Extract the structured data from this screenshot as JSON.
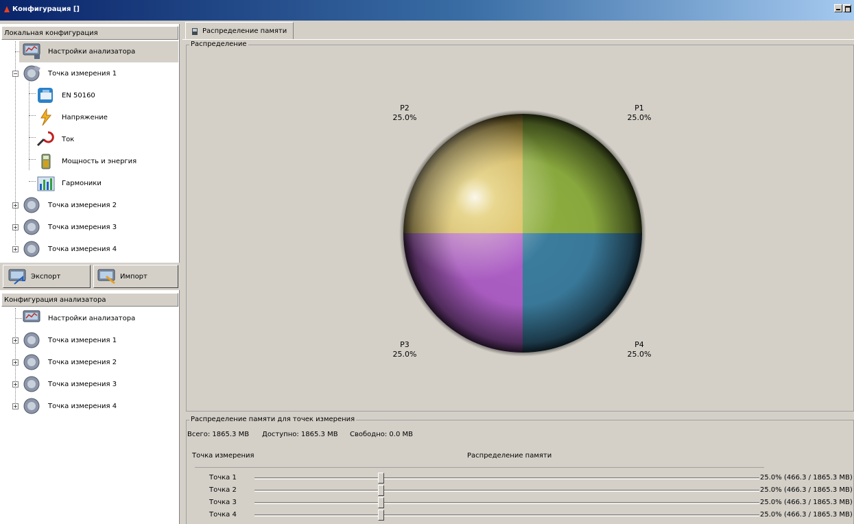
{
  "window": {
    "title": "Конфигурация []"
  },
  "local_config": {
    "header": "Локальная конфигурация",
    "items": [
      {
        "label": "Настройки анализатора",
        "icon": "analyzer-settings-icon"
      },
      {
        "label": "Точка измерения 1",
        "icon": "measurement-point-icon"
      },
      {
        "label": "EN 50160",
        "icon": "en50160-icon"
      },
      {
        "label": "Напряжение",
        "icon": "voltage-icon"
      },
      {
        "label": "Ток",
        "icon": "current-clamp-icon"
      },
      {
        "label": "Мощность и энергия",
        "icon": "power-energy-icon"
      },
      {
        "label": "Гармоники",
        "icon": "harmonics-icon"
      },
      {
        "label": "Точка измерения 2",
        "icon": "measurement-point-icon"
      },
      {
        "label": "Точка измерения 3",
        "icon": "measurement-point-icon"
      },
      {
        "label": "Точка измерения 4",
        "icon": "measurement-point-icon"
      }
    ]
  },
  "buttons": {
    "export": "Экспорт",
    "import": "Импорт"
  },
  "analyzer_config": {
    "header": "Конфигурация анализатора",
    "items": [
      {
        "label": "Настройки анализатора"
      },
      {
        "label": "Точка измерения 1"
      },
      {
        "label": "Точка измерения 2"
      },
      {
        "label": "Точка измерения 3"
      },
      {
        "label": "Точка измерения 4"
      }
    ]
  },
  "tab": {
    "label": "Распределение памяти"
  },
  "distribution": {
    "group_title": "Распределение",
    "labels": [
      {
        "name": "P2",
        "value": "25.0%"
      },
      {
        "name": "P1",
        "value": "25.0%"
      },
      {
        "name": "P3",
        "value": "25.0%"
      },
      {
        "name": "P4",
        "value": "25.0%"
      }
    ]
  },
  "chart_data": {
    "type": "pie",
    "categories": [
      "P1",
      "P2",
      "P3",
      "P4"
    ],
    "values": [
      25.0,
      25.0,
      25.0,
      25.0
    ],
    "colors": {
      "P1": "#8fb040",
      "P2": "#d8b850",
      "P3": "#b060c8",
      "P4": "#3c7ea0"
    }
  },
  "memory": {
    "group_title": "Распределение памяти для точек измерения",
    "total": "Всего: 1865.3 MB",
    "available": "Доступно: 1865.3 MB",
    "free": "Свободно: 0.0 MB",
    "col_point": "Точка измерения",
    "col_distribution": "Распределение памяти",
    "rows": [
      {
        "name": "Точка 1",
        "value": "25.0% (466.3 / 1865.3 MB)",
        "fraction": 0.25
      },
      {
        "name": "Точка 2",
        "value": "25.0% (466.3 / 1865.3 MB)",
        "fraction": 0.25
      },
      {
        "name": "Точка 3",
        "value": "25.0% (466.3 / 1865.3 MB)",
        "fraction": 0.25
      },
      {
        "name": "Точка 4",
        "value": "25.0% (466.3 / 1865.3 MB)",
        "fraction": 0.25
      }
    ]
  }
}
